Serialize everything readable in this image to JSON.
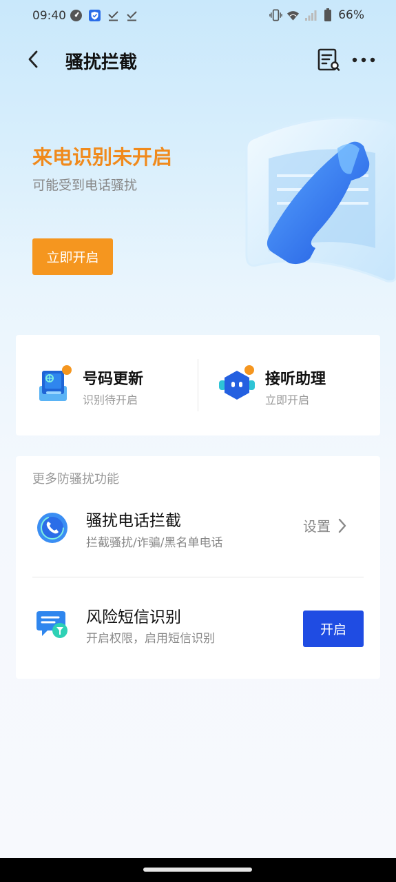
{
  "status_bar": {
    "time": "09:40",
    "battery": "66%"
  },
  "header": {
    "title": "骚扰拦截"
  },
  "hero": {
    "title": "来电识别未开启",
    "subtitle": "可能受到电话骚扰",
    "button": "立即开启",
    "accent": "#f5961f"
  },
  "quick_tiles": [
    {
      "title": "号码更新",
      "subtitle": "识别待开启"
    },
    {
      "title": "接听助理",
      "subtitle": "立即开启"
    }
  ],
  "more_section": {
    "label": "更多防骚扰功能",
    "items": [
      {
        "title": "骚扰电话拦截",
        "subtitle": "拦截骚扰/诈骗/黑名单电话",
        "action": "设置"
      },
      {
        "title": "风险短信识别",
        "subtitle": "开启权限，启用短信识别",
        "action": "开启"
      }
    ]
  },
  "colors": {
    "primary_button": "#1f4ce3",
    "badge_dot": "#f5961f"
  }
}
